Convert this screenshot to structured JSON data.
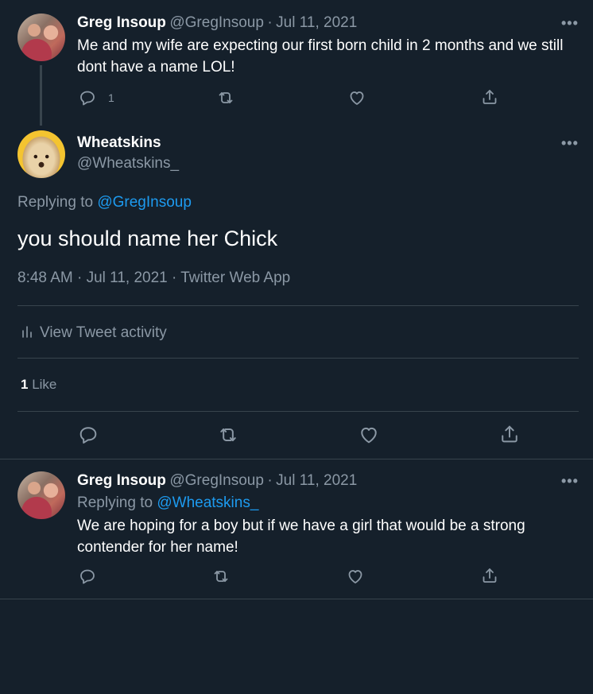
{
  "tweet1": {
    "author_name": "Greg Insoup",
    "author_handle": "@GregInsoup",
    "separator": "·",
    "date": "Jul 11, 2021",
    "text": "Me and my wife are expecting our first born child in 2 months and we still dont have a name LOL!",
    "reply_count": "1"
  },
  "main": {
    "author_name": "Wheatskins",
    "author_handle": "@Wheatskins_",
    "replying_to_prefix": "Replying to",
    "replying_to_handle": "@GregInsoup",
    "text": "you should name her Chick",
    "meta": "8:48 AM · Jul 11, 2021 · Twitter Web App",
    "activity_label": "View Tweet activity",
    "like_count": "1",
    "like_label": "Like"
  },
  "tweet3": {
    "author_name": "Greg Insoup",
    "author_handle": "@GregInsoup",
    "separator": "·",
    "date": "Jul 11, 2021",
    "replying_to_prefix": "Replying to",
    "replying_to_handle": "@Wheatskins_",
    "text": "We are hoping for a boy but if we have a girl that would be a strong contender for her name!"
  },
  "more_glyph": "•••",
  "colors": {
    "background": "#15202b",
    "text": "#ffffff",
    "secondary": "#8b98a5",
    "accent": "#1d9bf0",
    "divider": "#38444d"
  },
  "icons": [
    "reply-icon",
    "retweet-icon",
    "like-icon",
    "share-icon",
    "more-icon",
    "analytics-icon"
  ]
}
